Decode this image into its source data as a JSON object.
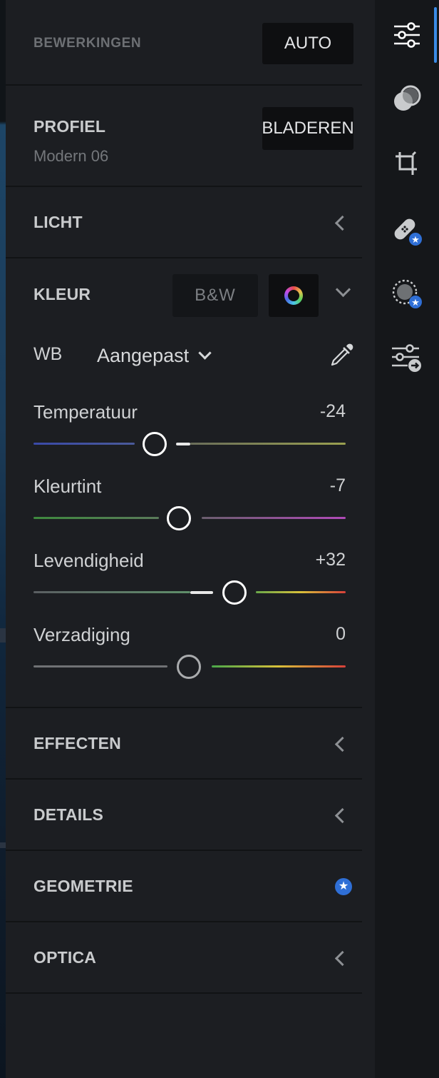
{
  "header": {
    "title": "BEWERKINGEN",
    "auto_label": "AUTO"
  },
  "profile": {
    "title": "PROFIEL",
    "value": "Modern 06",
    "browse_label": "BLADEREN"
  },
  "sections": {
    "light": "LICHT",
    "color": "KLEUR",
    "effects": "EFFECTEN",
    "details": "DETAILS",
    "geometry": "GEOMETRIE",
    "optics": "OPTICA"
  },
  "color": {
    "bw_label": "B&W",
    "wb_label": "WB",
    "wb_value": "Aangepast",
    "sliders": [
      {
        "label": "Temperatuur",
        "value": "-24",
        "level": -24
      },
      {
        "label": "Kleurtint",
        "value": "-7",
        "level": -7
      },
      {
        "label": "Levendigheid",
        "value": "+32",
        "level": 32
      },
      {
        "label": "Verzadiging",
        "value": "0",
        "level": 0
      }
    ]
  },
  "rail": {
    "icons": [
      "edit-sliders-icon",
      "selective-mask-icon",
      "crop-icon",
      "healing-bandage-icon",
      "blur-mask-icon",
      "presets-icon"
    ]
  },
  "colors": {
    "accent": "#3a8be6",
    "premium_badge": "#2f6fd6"
  }
}
